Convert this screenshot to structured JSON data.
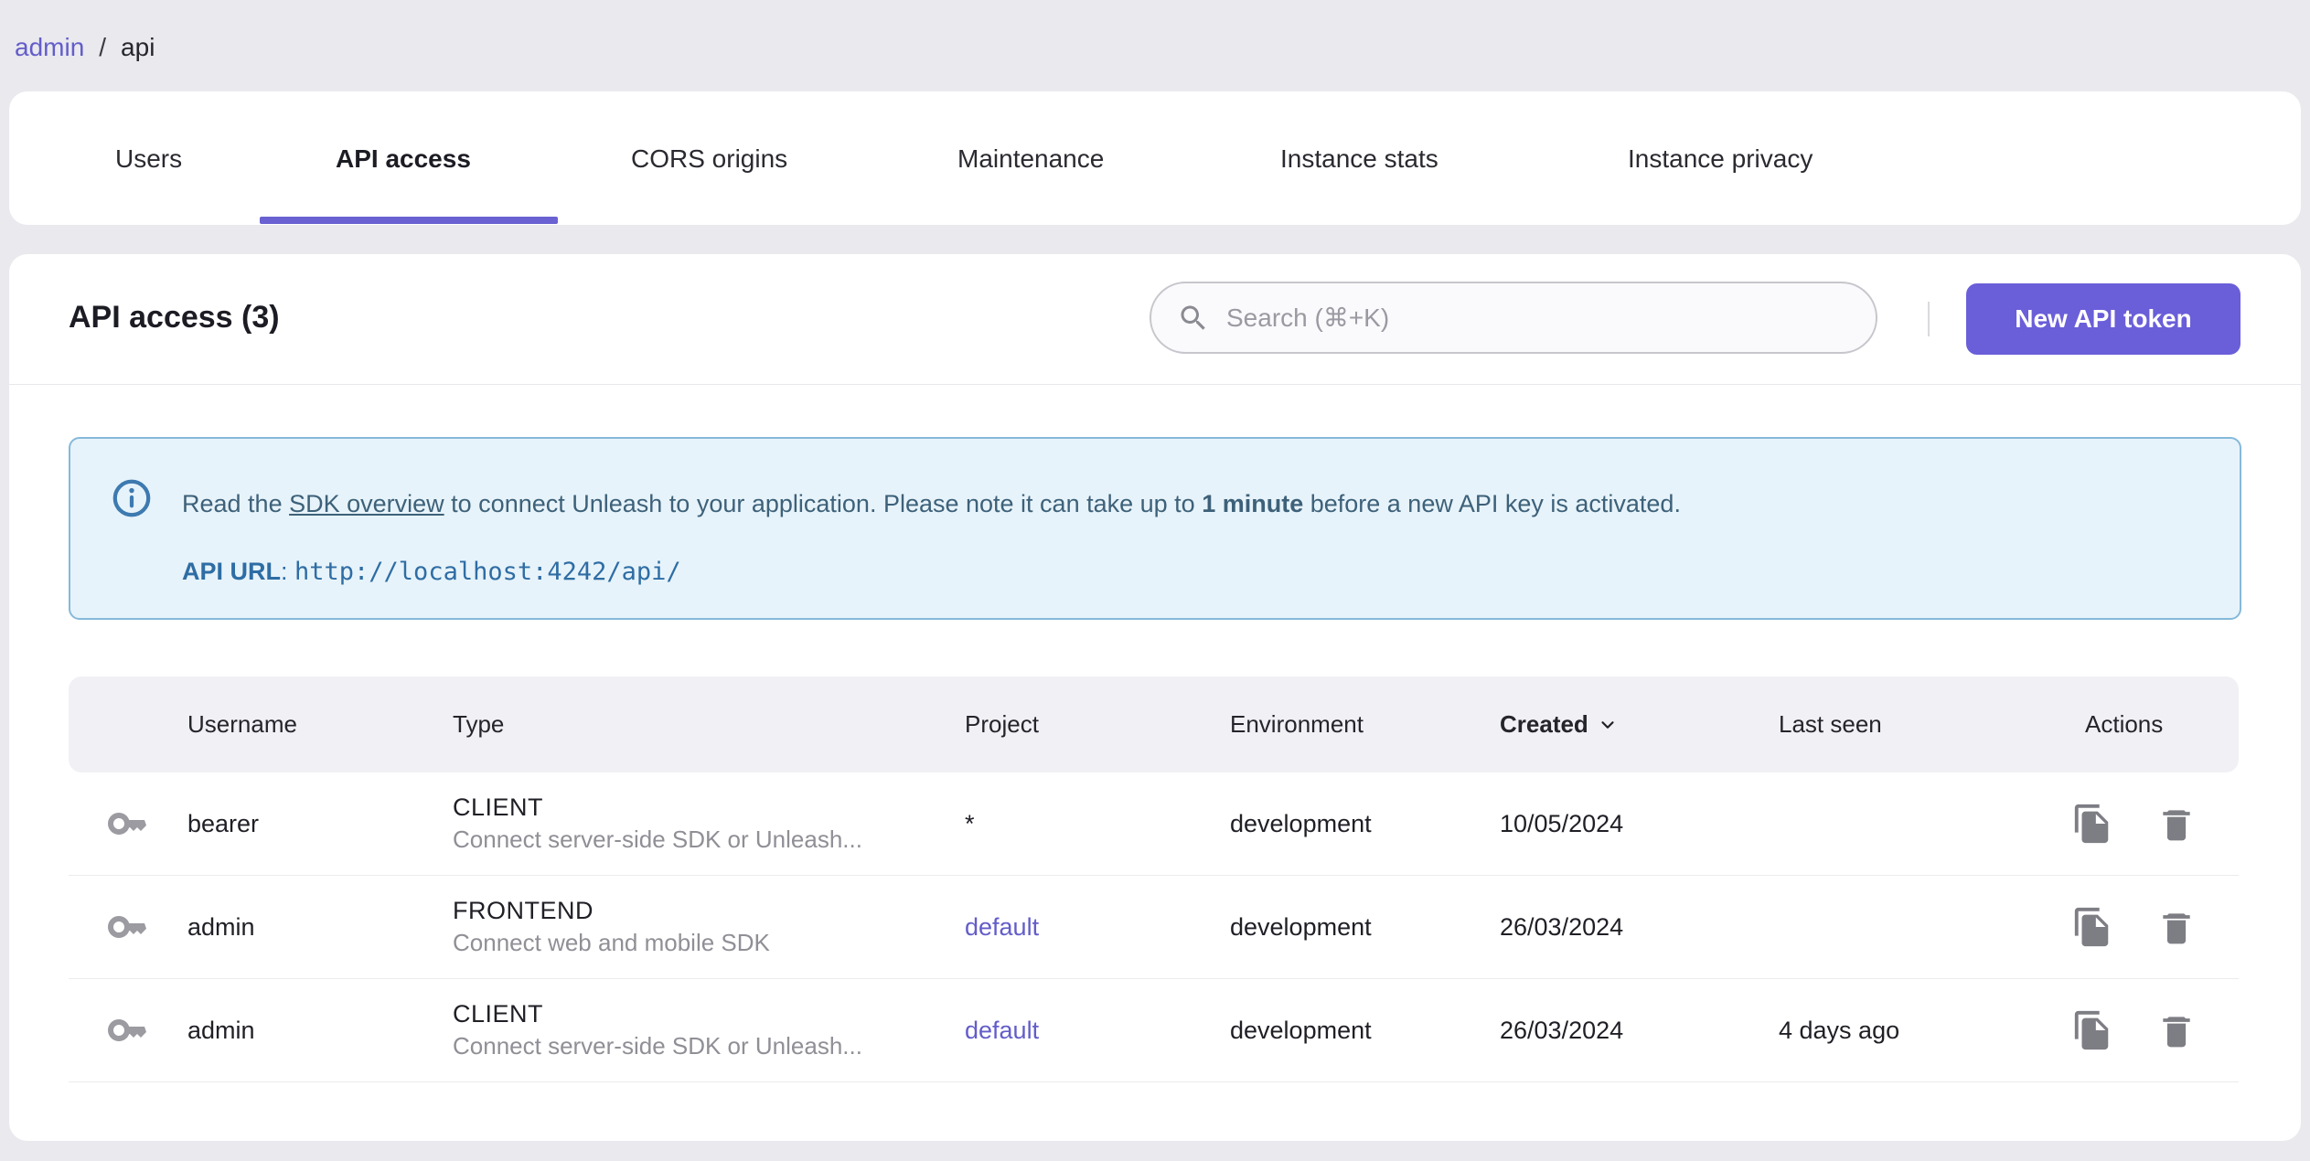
{
  "breadcrumb": {
    "separator": "/",
    "items": [
      {
        "label": "admin"
      },
      {
        "label": "api"
      }
    ]
  },
  "tabs": [
    {
      "label": "Users",
      "active": false
    },
    {
      "label": "API access",
      "active": true
    },
    {
      "label": "CORS origins",
      "active": false
    },
    {
      "label": "Maintenance",
      "active": false
    },
    {
      "label": "Instance stats",
      "active": false
    },
    {
      "label": "Instance privacy",
      "active": false
    }
  ],
  "header": {
    "title": "API access (3)",
    "search_placeholder": "Search (⌘+K)",
    "new_token_label": "New API token"
  },
  "banner": {
    "text_prefix": "Read the ",
    "link_text": "SDK overview",
    "text_mid": " to connect Unleash to your application. Please note it can take up to ",
    "bold_text": "1 minute",
    "text_suffix": " before a new API key is activated.",
    "api_url_label": "API URL",
    "api_url_separator": ": ",
    "api_url": "http://localhost:4242/api/"
  },
  "table": {
    "columns": [
      "Username",
      "Type",
      "Project",
      "Environment",
      "Created",
      "Last seen",
      "Actions"
    ],
    "sorted_column": "Created",
    "sort_direction": "desc",
    "rows": [
      {
        "username": "bearer",
        "type": "CLIENT",
        "type_description": "Connect server-side SDK or Unleash...",
        "project": "*",
        "project_is_link": false,
        "environment": "development",
        "created": "10/05/2024",
        "last_seen": ""
      },
      {
        "username": "admin",
        "type": "FRONTEND",
        "type_description": "Connect web and mobile SDK",
        "project": "default",
        "project_is_link": true,
        "environment": "development",
        "created": "26/03/2024",
        "last_seen": ""
      },
      {
        "username": "admin",
        "type": "CLIENT",
        "type_description": "Connect server-side SDK or Unleash...",
        "project": "default",
        "project_is_link": true,
        "environment": "development",
        "created": "26/03/2024",
        "last_seen": "4 days ago"
      }
    ]
  },
  "colors": {
    "accent_purple": "#6a5ed9",
    "tab_underline": "#6a62d2",
    "link_purple": "#635dc9",
    "banner_background": "#e7f3fa",
    "banner_border": "#85b9da",
    "banner_text": "#3d6179",
    "banner_url": "#2e6da4",
    "page_background": "#e9e9ee",
    "table_header_background": "#f1f0f5",
    "icon_gray": "#7d7d84",
    "key_icon_gray": "#9b9ba1"
  }
}
